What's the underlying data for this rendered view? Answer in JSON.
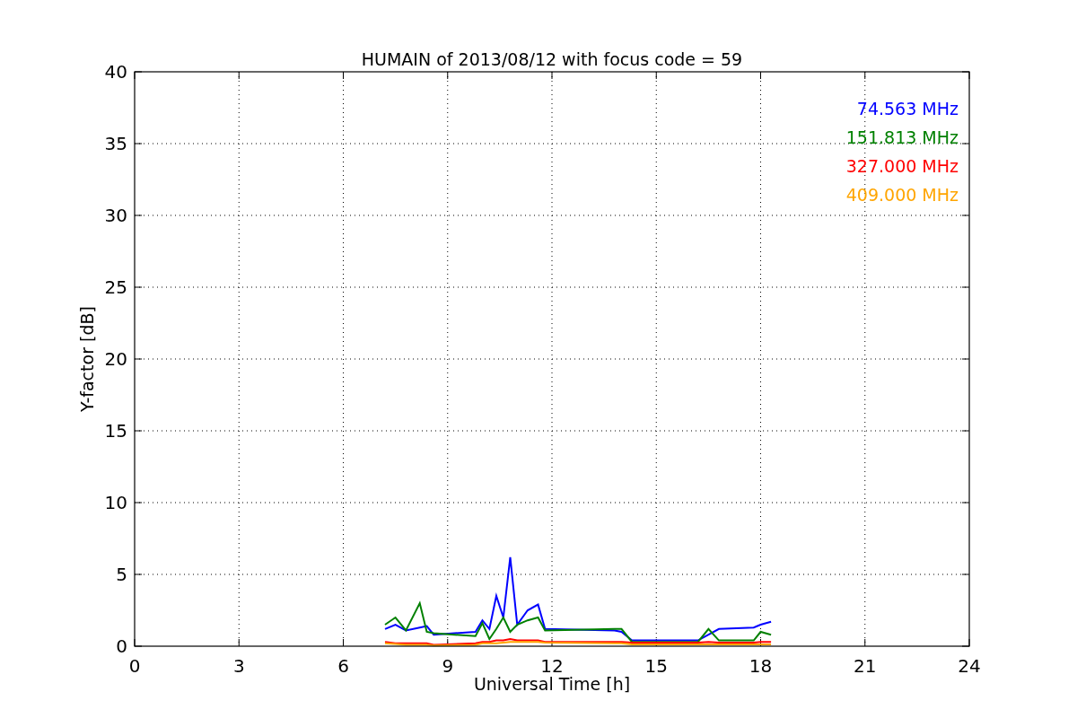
{
  "chart_data": {
    "type": "line",
    "title": "HUMAIN of 2013/08/12 with focus code = 59",
    "xlabel": "Universal Time [h]",
    "ylabel": "Y-factor [dB]",
    "x": [
      7.2,
      7.5,
      7.8,
      8.2,
      8.4,
      8.6,
      9.8,
      10.0,
      10.2,
      10.4,
      10.6,
      10.8,
      11.0,
      11.3,
      11.6,
      11.8,
      13.8,
      14.0,
      14.3,
      16.2,
      16.5,
      16.8,
      17.8,
      18.0,
      18.3
    ],
    "series": [
      {
        "name": "74.563 MHz",
        "color": "#0000ff",
        "values": [
          1.2,
          1.5,
          1.1,
          1.3,
          1.4,
          0.8,
          1.0,
          1.8,
          1.2,
          3.5,
          2.0,
          6.2,
          1.5,
          2.5,
          2.9,
          1.2,
          1.1,
          1.0,
          0.4,
          0.4,
          0.8,
          1.2,
          1.3,
          1.5,
          1.7
        ]
      },
      {
        "name": "151.813 MHz",
        "color": "#008000",
        "values": [
          1.5,
          2.0,
          1.1,
          3.0,
          1.0,
          0.9,
          0.7,
          1.6,
          0.5,
          1.2,
          2.0,
          1.0,
          1.5,
          1.8,
          2.0,
          1.1,
          1.2,
          1.2,
          0.3,
          0.3,
          1.2,
          0.4,
          0.4,
          1.0,
          0.8
        ]
      },
      {
        "name": "327.000 MHz",
        "color": "#ff0000",
        "values": [
          0.3,
          0.2,
          0.2,
          0.2,
          0.2,
          0.1,
          0.2,
          0.3,
          0.3,
          0.4,
          0.4,
          0.5,
          0.4,
          0.4,
          0.4,
          0.3,
          0.3,
          0.3,
          0.25,
          0.25,
          0.3,
          0.25,
          0.25,
          0.3,
          0.3
        ]
      },
      {
        "name": "409.000 MHz",
        "color": "#ffa500",
        "values": [
          0.2,
          0.15,
          0.1,
          0.1,
          0.1,
          0.05,
          0.1,
          0.2,
          0.2,
          0.2,
          0.25,
          0.3,
          0.3,
          0.3,
          0.3,
          0.25,
          0.2,
          0.2,
          0.12,
          0.12,
          0.12,
          0.12,
          0.12,
          0.12,
          0.12
        ]
      }
    ],
    "grid": true,
    "xlim": [
      0,
      24
    ],
    "ylim": [
      0,
      40
    ],
    "xticks": [
      0,
      3,
      6,
      9,
      12,
      15,
      18,
      21,
      24
    ],
    "yticks": [
      0,
      5,
      10,
      15,
      20,
      25,
      30,
      35,
      40
    ]
  }
}
